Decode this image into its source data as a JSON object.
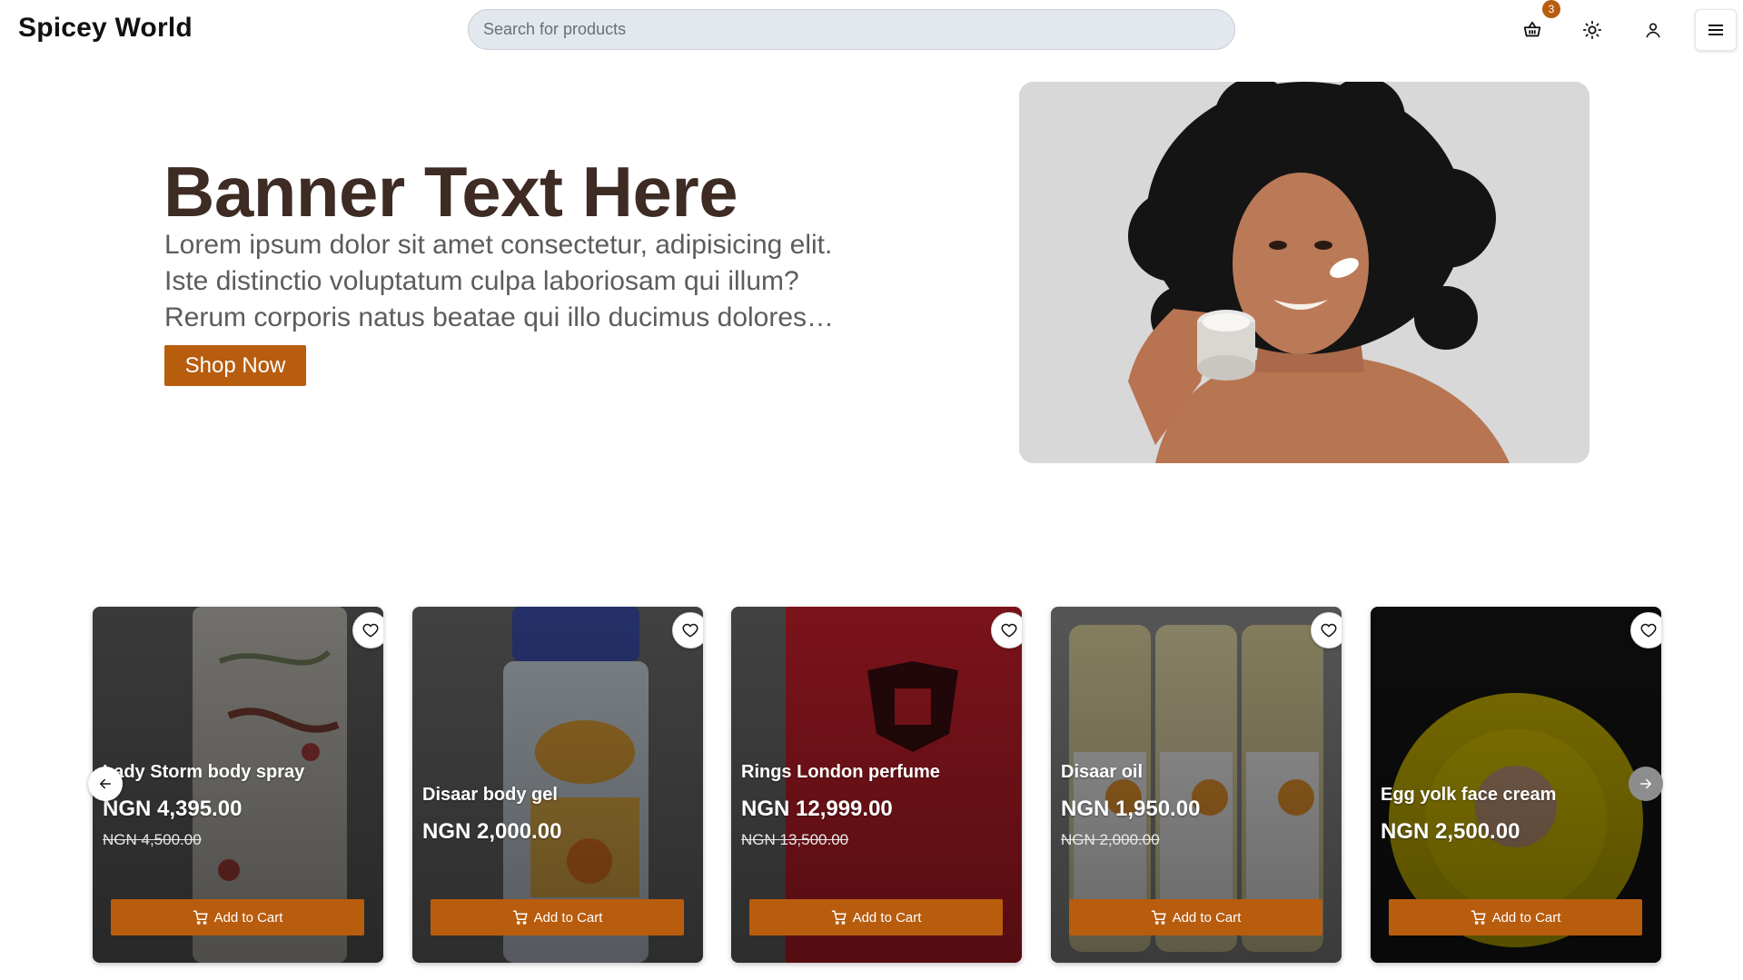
{
  "header": {
    "brand": "Spicey World",
    "search_placeholder": "Search for products",
    "cart_count": "3"
  },
  "hero": {
    "title": "Banner Text Here",
    "description": "Lorem ipsum dolor sit amet consectetur, adipisicing elit. Iste distinctio voluptatum culpa laboriosam qui illum? Rerum corporis natus beatae qui illo ducimus dolores accusantium.",
    "cta": "Shop Now"
  },
  "products": [
    {
      "name": "Lady Storm body spray",
      "price": "NGN 4,395.00",
      "old_price": "NGN 4,500.00",
      "cta": "Add to Cart"
    },
    {
      "name": "Disaar body gel",
      "price": "NGN 2,000.00",
      "old_price": "",
      "cta": "Add to Cart"
    },
    {
      "name": "Rings London perfume",
      "price": "NGN 12,999.00",
      "old_price": "NGN 13,500.00",
      "cta": "Add to Cart"
    },
    {
      "name": "Disaar oil",
      "price": "NGN 1,950.00",
      "old_price": "NGN 2,000.00",
      "cta": "Add to Cart"
    },
    {
      "name": "Egg yolk face cream",
      "price": "NGN 2,500.00",
      "old_price": "",
      "cta": "Add to Cart"
    }
  ],
  "colors": {
    "accent": "#b85c0e",
    "hero_title": "#3d2b24"
  }
}
